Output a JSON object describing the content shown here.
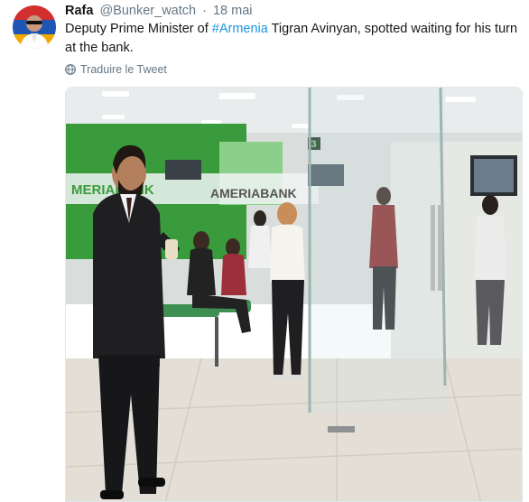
{
  "tweet": {
    "display_name": "Rafa",
    "handle": "@Bunker_watch",
    "separator": "·",
    "date": "18 mai",
    "text_before": "Deputy Prime Minister of ",
    "hashtag": "#Armenia",
    "text_after": " Tigran Avinyan, spotted waiting for his turn at the bank.",
    "translate_label": "Traduire le Tweet"
  },
  "photo": {
    "bank_sign_main": "AMERIABANK",
    "bank_sign_left": "MERIABANK",
    "counter_number": "3"
  },
  "icons": {
    "avatar": "avatar-image",
    "translate": "globe-icon"
  },
  "colors": {
    "hashtag": "#1b95e0",
    "secondary_text": "#657786",
    "bank_green": "#3a9b3c"
  }
}
